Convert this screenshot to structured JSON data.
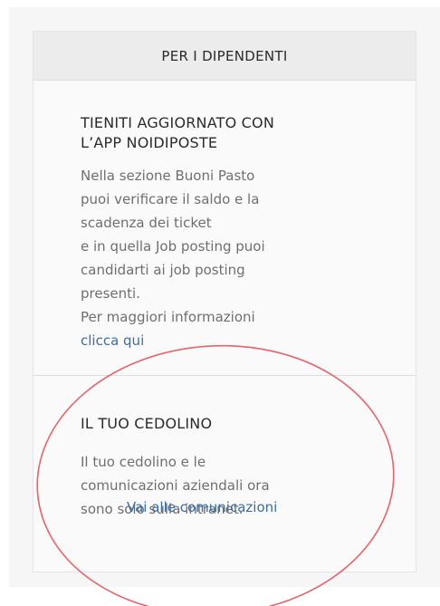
{
  "header": {
    "title": "PER I DIPENDENTI"
  },
  "app_section": {
    "title": "TIENITI AGGIORNATO CON\nL’APP NOIDIPOSTE",
    "lines": [
      "Nella sezione Buoni Pasto",
      "puoi verificare il saldo e la",
      "scadenza dei ticket",
      "e in quella Job posting puoi",
      "candidarti ai job posting",
      "presenti.",
      "Per maggiori informazioni"
    ],
    "link_label": "clicca qui"
  },
  "payslip_section": {
    "title": "IL TUO CEDOLINO",
    "lines": [
      "Il tuo cedolino e le",
      "comunicazioni aziendali ora",
      "sono solo sulla intranet."
    ],
    "link_label": "Vai alle comunicazioni"
  },
  "colors": {
    "link": "#3b6ea8",
    "annotation_circle": "#e8636b",
    "header_bg": "#ececec",
    "card_bg": "#fafafa"
  }
}
